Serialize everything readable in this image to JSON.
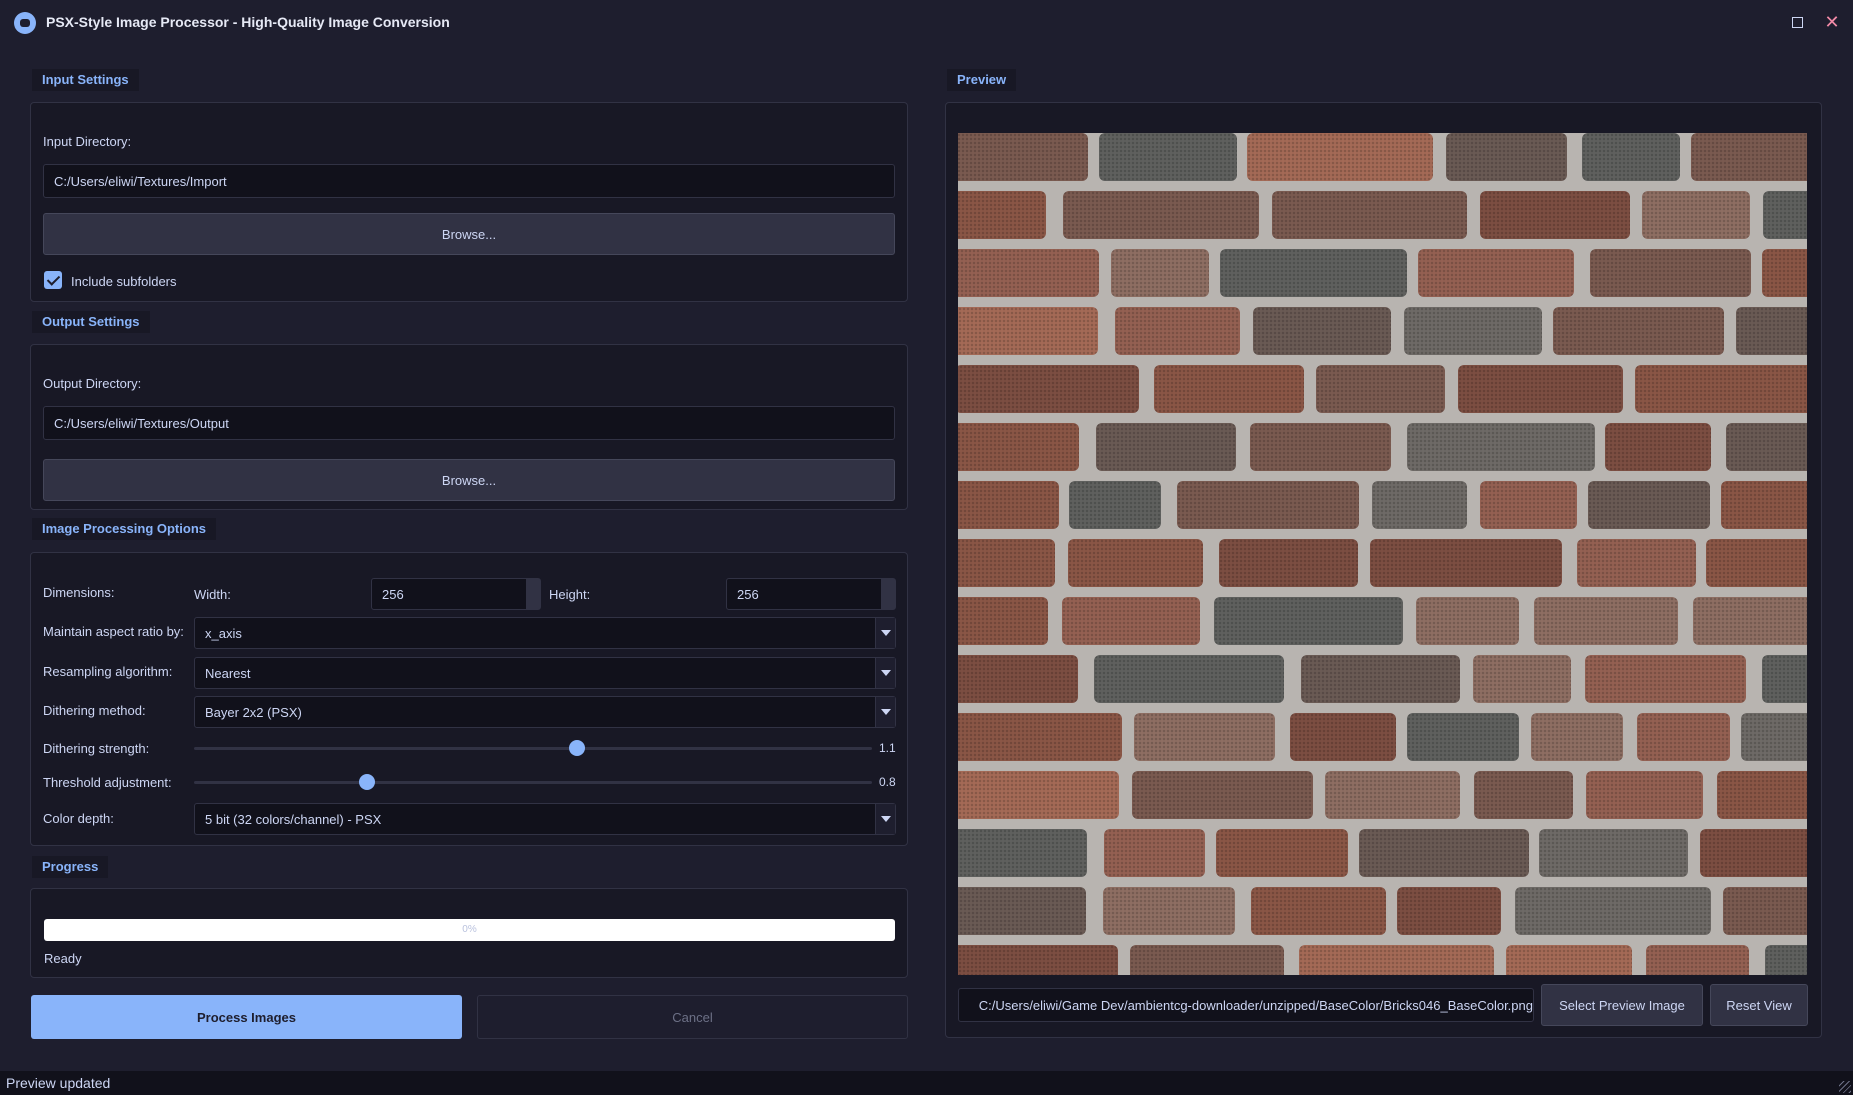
{
  "window": {
    "title": "PSX-Style Image Processor - High-Quality Image Conversion",
    "maximize_icon": "maximize-icon",
    "close_icon": "close-icon",
    "close_glyph": "✕"
  },
  "input_settings": {
    "group_title": "Input Settings",
    "directory_label": "Input Directory:",
    "directory_value": "C:/Users/eliwi/Textures/Import",
    "browse_label": "Browse...",
    "include_subfolders_label": "Include subfolders",
    "include_subfolders_checked": true
  },
  "output_settings": {
    "group_title": "Output Settings",
    "directory_label": "Output Directory:",
    "directory_value": "C:/Users/eliwi/Textures/Output",
    "browse_label": "Browse..."
  },
  "processing": {
    "group_title": "Image Processing Options",
    "dimensions_label": "Dimensions:",
    "width_label": "Width:",
    "width_value": "256",
    "height_label": "Height:",
    "height_value": "256",
    "aspect_label": "Maintain aspect ratio by:",
    "aspect_value": "x_axis",
    "resampling_label": "Resampling algorithm:",
    "resampling_value": "Nearest",
    "dithering_label": "Dithering method:",
    "dithering_value": "Bayer 2x2 (PSX)",
    "dither_strength_label": "Dithering strength:",
    "dither_strength_value": "1.1",
    "dither_strength_fraction": 0.565,
    "threshold_label": "Threshold adjustment:",
    "threshold_value": "0.8",
    "threshold_fraction": 0.255,
    "color_depth_label": "Color depth:",
    "color_depth_value": "5 bit (32 colors/channel) - PSX"
  },
  "progress": {
    "group_title": "Progress",
    "percent_text": "0%",
    "percent_value": 0,
    "status_text": "Ready"
  },
  "actions": {
    "process_label": "Process Images",
    "cancel_label": "Cancel"
  },
  "preview": {
    "group_title": "Preview",
    "image_path": "C:/Users/eliwi/Game Dev/ambientcg-downloader/unzipped/BaseColor/Bricks046_BaseColor.png",
    "select_label": "Select Preview Image",
    "reset_label": "Reset View"
  },
  "status_bar": {
    "message": "Preview updated"
  },
  "colors": {
    "accent": "#89b4fa",
    "background": "#1e1e2e",
    "panel": "#181825"
  }
}
